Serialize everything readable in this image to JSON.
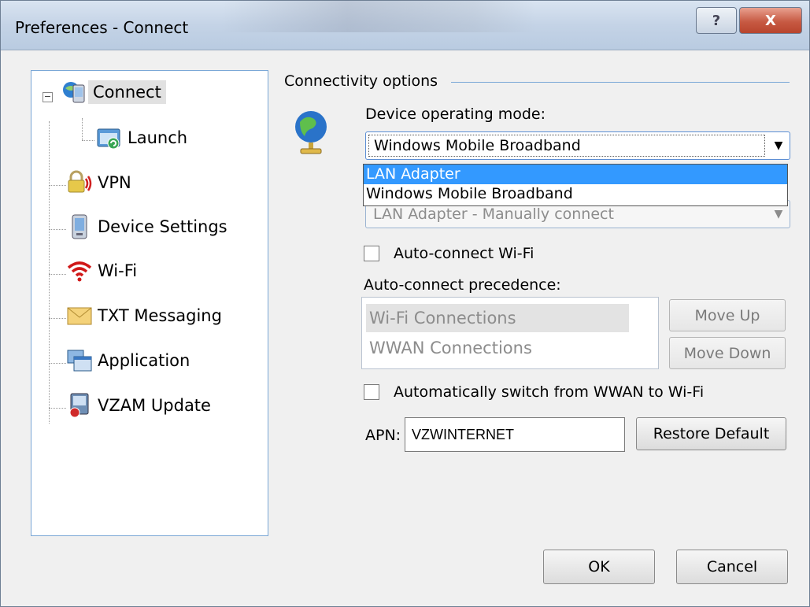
{
  "window": {
    "title": "Preferences - Connect",
    "help_label": "?",
    "close_label": "X"
  },
  "tree": {
    "items": [
      {
        "label": "Connect",
        "icon": "connect-icon"
      },
      {
        "label": "Launch",
        "icon": "launch-icon"
      },
      {
        "label": "VPN",
        "icon": "vpn-icon"
      },
      {
        "label": "Device Settings",
        "icon": "device-icon"
      },
      {
        "label": "Wi-Fi",
        "icon": "wifi-icon"
      },
      {
        "label": "TXT Messaging",
        "icon": "envelope-icon"
      },
      {
        "label": "Application",
        "icon": "application-icon"
      },
      {
        "label": "VZAM Update",
        "icon": "update-icon"
      }
    ],
    "expander": "−"
  },
  "connectivity": {
    "group_title": "Connectivity options",
    "op_mode_label": "Device operating mode:",
    "op_mode_value": "Windows Mobile Broadband",
    "dropdown_options": [
      "LAN Adapter",
      "Windows Mobile Broadband"
    ],
    "lan_mode_value": "LAN Adapter - Manually connect",
    "auto_wifi_label": "Auto-connect Wi-Fi",
    "precedence_label": "Auto-connect precedence:",
    "precedence_items": [
      "Wi-Fi Connections",
      "WWAN Connections"
    ],
    "move_up": "Move Up",
    "move_down": "Move Down",
    "auto_switch_label": "Automatically switch from WWAN to Wi-Fi",
    "apn_label": "APN:",
    "apn_value": "VZWINTERNET",
    "restore_default": "Restore Default"
  },
  "footer": {
    "ok": "OK",
    "cancel": "Cancel"
  },
  "colors": {
    "accent": "#3399ff",
    "close_button": "#c75a43"
  }
}
